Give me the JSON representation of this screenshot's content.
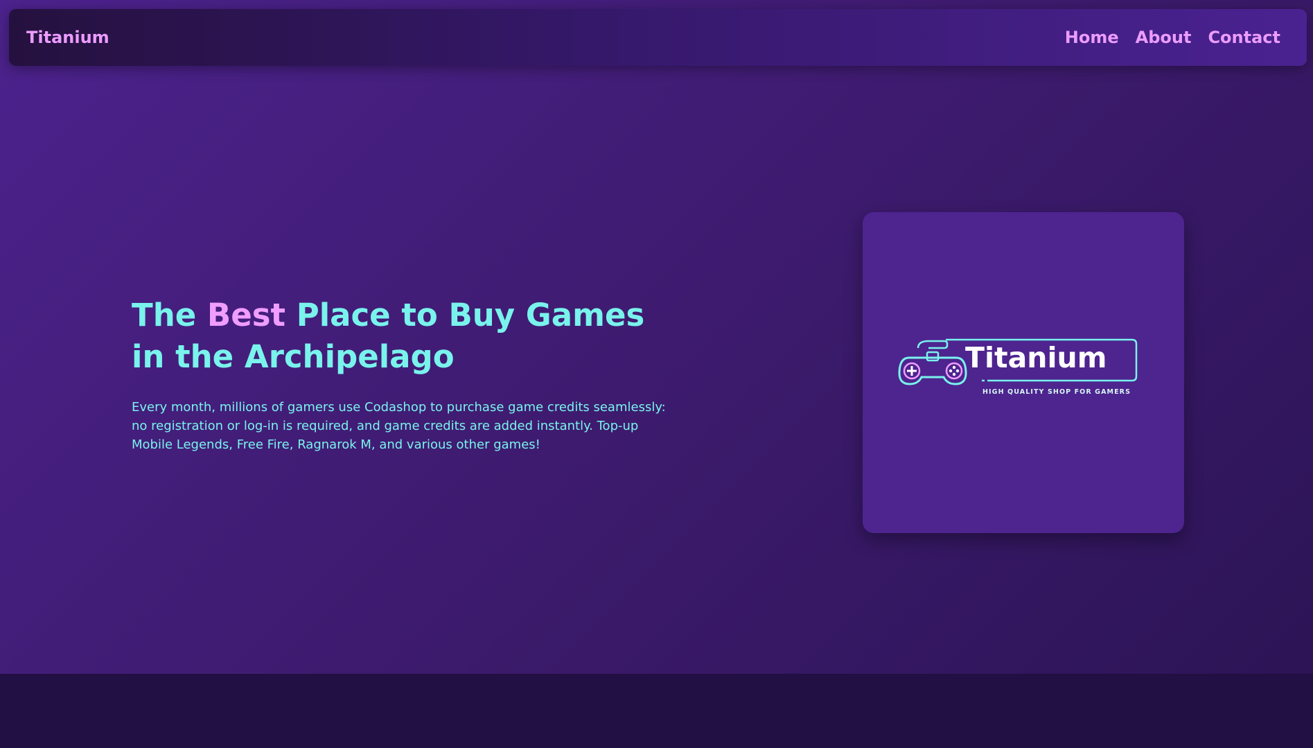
{
  "nav": {
    "brand": "Titanium",
    "links": [
      {
        "label": "Home"
      },
      {
        "label": "About"
      },
      {
        "label": "Contact"
      }
    ]
  },
  "hero": {
    "headline_pre": "The ",
    "headline_accent": "Best",
    "headline_post": " Place to Buy Games in the Archipelago",
    "description": "Every month, millions of gamers use Codashop to purchase game credits seamlessly: no registration or log-in is required, and game credits are added instantly. Top-up Mobile Legends, Free Fire, Ragnarok M, and various other games!"
  },
  "logo": {
    "name": "Titanium",
    "tagline": "HIGH QUALITY SHOP FOR GAMERS",
    "icon": "gamepad-icon"
  },
  "colors": {
    "accent_cyan": "#79f3ec",
    "accent_pink": "#ec9cff",
    "hero_purple": "#4c228d",
    "card_purple": "#4e248f",
    "footer_dark": "#220f43"
  }
}
